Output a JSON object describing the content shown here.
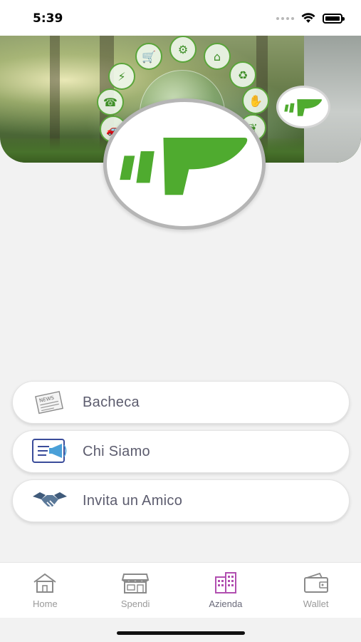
{
  "status_bar": {
    "time": "5:39"
  },
  "banner": {
    "icons": [
      "cart-icon",
      "tool-icon",
      "house-icon",
      "recycle-icon",
      "handshake-icon",
      "meter-icon",
      "leaf-icon",
      "phone-icon",
      "car-icon"
    ]
  },
  "brand": {
    "accent": "#4fab2f"
  },
  "menu": {
    "items": [
      {
        "label": "Bacheca",
        "icon": "news-icon"
      },
      {
        "label": "Chi Siamo",
        "icon": "megaphone-icon"
      },
      {
        "label": "Invita un Amico",
        "icon": "handshake-icon"
      }
    ]
  },
  "tabbar": {
    "tabs": [
      {
        "label": "Home",
        "icon": "house-icon",
        "active": false
      },
      {
        "label": "Spendi",
        "icon": "shop-icon",
        "active": false
      },
      {
        "label": "Azienda",
        "icon": "building-icon",
        "active": true
      },
      {
        "label": "Wallet",
        "icon": "wallet-icon",
        "active": false
      }
    ]
  }
}
